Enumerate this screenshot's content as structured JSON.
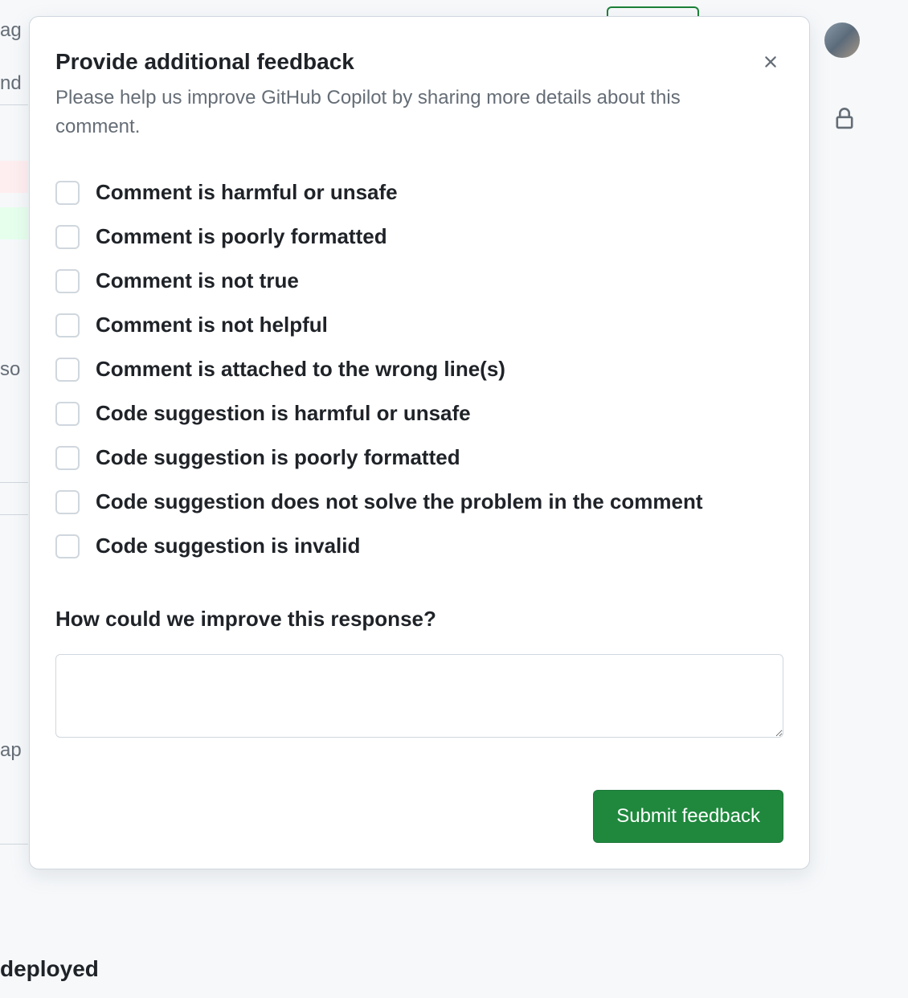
{
  "modal": {
    "title": "Provide additional feedback",
    "subtitle": "Please help us improve GitHub Copilot by sharing more details about this comment.",
    "checkboxes": [
      {
        "label": "Comment is harmful or unsafe"
      },
      {
        "label": "Comment is poorly formatted"
      },
      {
        "label": "Comment is not true"
      },
      {
        "label": "Comment is not helpful"
      },
      {
        "label": "Comment is attached to the wrong line(s)"
      },
      {
        "label": "Code suggestion is harmful or unsafe"
      },
      {
        "label": "Code suggestion is poorly formatted"
      },
      {
        "label": "Code suggestion does not solve the problem in the comment"
      },
      {
        "label": "Code suggestion is invalid"
      }
    ],
    "improve_label": "How could we improve this response?",
    "textarea_value": "",
    "submit_label": "Submit feedback"
  },
  "background": {
    "fragments": {
      "ag": "ag",
      "nd": "nd",
      "so": "so",
      "ap": "ap",
      "deployed": "deployed"
    }
  }
}
